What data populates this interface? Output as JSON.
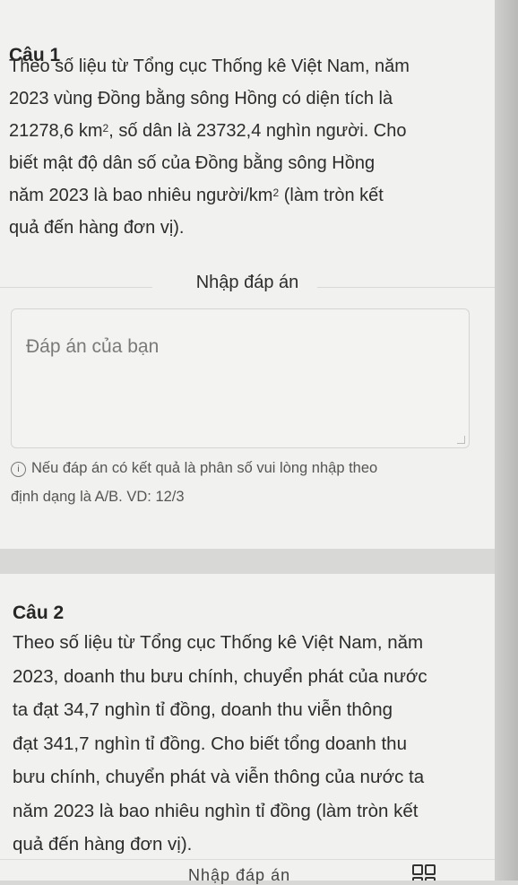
{
  "question1": {
    "title": "Câu 1",
    "lines": [
      "Theo số liệu từ Tổng cục Thống kê Việt Nam, năm",
      "2023 vùng Đồng bằng sông Hồng có diện tích là",
      "21278,6 km",
      "2",
      ", số dân là 23732,4 nghìn người. Cho",
      "biết mật độ dân số của Đồng bằng sông Hồng",
      "năm 2023 là bao nhiêu người/km",
      "2",
      " (làm tròn kết",
      "quả đến hàng đơn vị)."
    ]
  },
  "answer_section": {
    "label": "Nhập đáp án",
    "placeholder": "Đáp án của bạn",
    "hint_icon": "info-icon",
    "hint_line1": "Nếu đáp án có kết quả là phân số vui lòng nhập theo",
    "hint_line2": "định dạng là A/B. VD: 12/3"
  },
  "question2": {
    "title": "Câu 2",
    "lines": [
      "Theo số liệu từ Tổng cục Thống kê Việt Nam, năm",
      "2023, doanh thu bưu chính, chuyển phát của nước",
      "ta đạt 34,7 nghìn tỉ đồng, doanh thu viễn thông",
      "đạt 341,7 nghìn tỉ đồng. Cho biết tổng doanh thu",
      "bưu chính, chuyển phát và viễn thông của nước ta",
      "năm 2023 là bao nhiêu nghìn tỉ đồng (làm tròn kết",
      "quả đến hàng đơn vị)."
    ],
    "next_label_cut": "Nhập đáp án"
  },
  "icons": {
    "grid": "grid-icon"
  }
}
